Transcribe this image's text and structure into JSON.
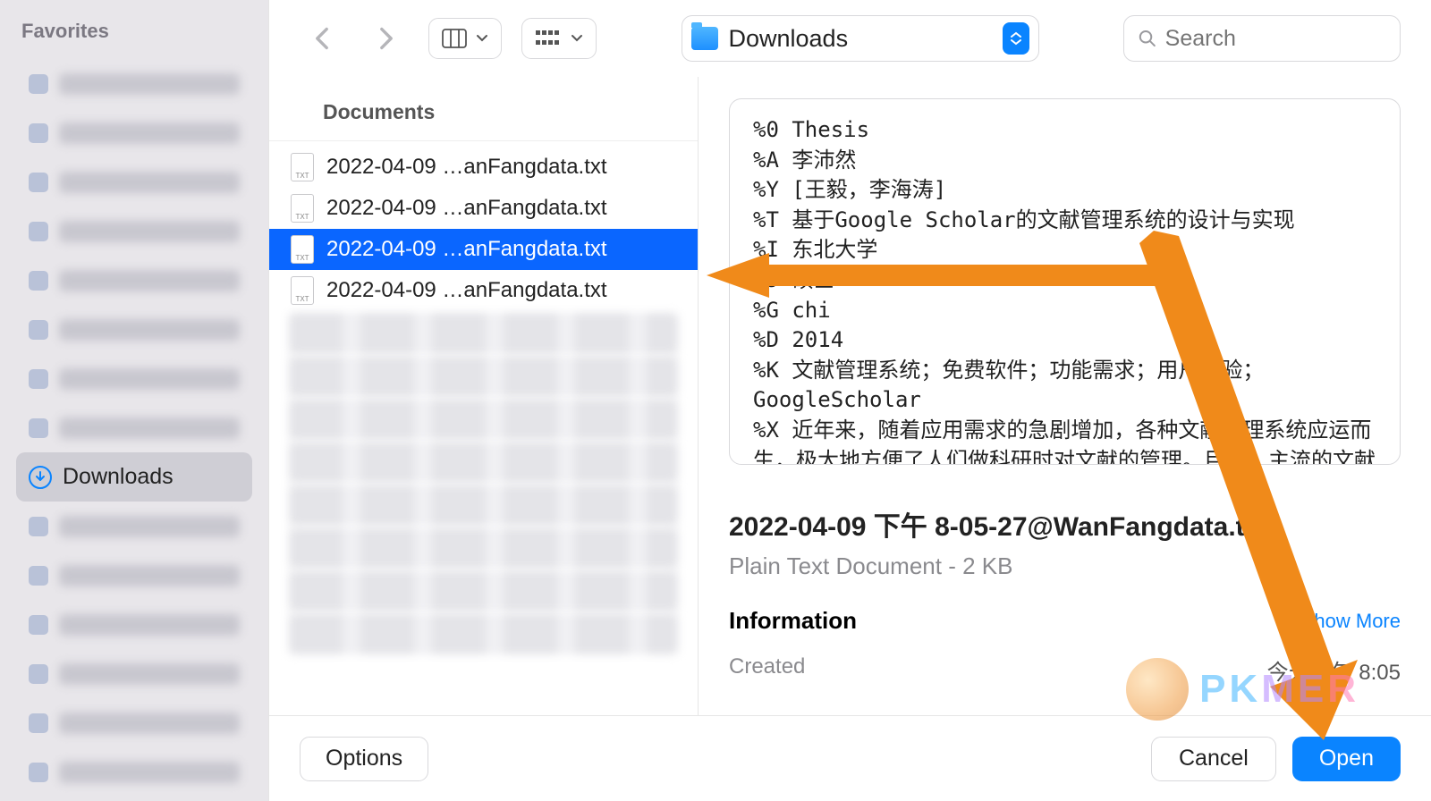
{
  "sidebar": {
    "title": "Favorites",
    "active_label": "Downloads",
    "blurred_count_before": 8,
    "blurred_count_after": 6
  },
  "toolbar": {
    "location": "Downloads",
    "search_placeholder": "Search"
  },
  "column_header": "Documents",
  "files": [
    {
      "name": "2022-04-09 …anFangdata.txt",
      "selected": false
    },
    {
      "name": "2022-04-09 …anFangdata.txt",
      "selected": false
    },
    {
      "name": "2022-04-09 …anFangdata.txt",
      "selected": true
    },
    {
      "name": "2022-04-09 …anFangdata.txt",
      "selected": false
    }
  ],
  "blur_rows": 8,
  "preview": {
    "lines": [
      "%0 Thesis",
      "%A 李沛然",
      "%Y [王毅，李海涛]",
      "%T 基于Google Scholar的文献管理系统的设计与实现",
      "%I 东北大学",
      "%9 硕士",
      "%G chi",
      "%D 2014",
      "%K 文献管理系统；免费软件；功能需求；用户体验；GoogleScholar",
      "%X 近年来，随着应用需求的急剧增加，各种文献管理系统应运而生，极大地方便了人们做科研时对文献的管理。目前，主流的文献管理系统有EndNote、Mendeley、Zotero、Reference Manager、NoteFirst、NoteExpress等。这些文献管理系统各有所长，分别适用于不同的管理需"
    ],
    "filename": "2022-04-09 下午 8-05-27@WanFangdata.txt",
    "kind": "Plain Text Document - 2 KB",
    "info_label": "Information",
    "show_more": "Show More",
    "created_label": "Created",
    "created_value": "今天下午 8:05"
  },
  "footer": {
    "options": "Options",
    "cancel": "Cancel",
    "open": "Open"
  },
  "watermark": "PKMER",
  "colors": {
    "accent": "#0a84ff",
    "annotation": "#f08a1a"
  }
}
